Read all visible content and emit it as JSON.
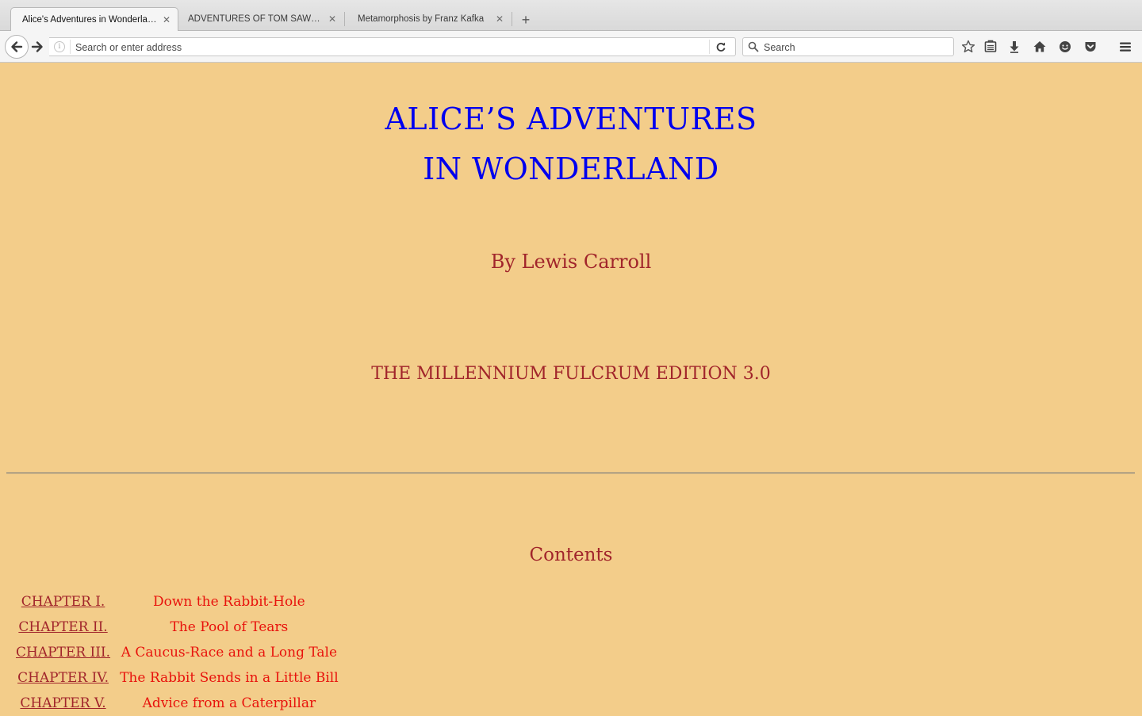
{
  "tabs": [
    {
      "label": "Alice's Adventures in Wonderla…",
      "active": true
    },
    {
      "label": "ADVENTURES OF TOM SAWYE…",
      "active": false
    },
    {
      "label": "Metamorphosis by Franz Kafka",
      "active": false
    }
  ],
  "tab_close_glyph": "✕",
  "new_tab_glyph": "+",
  "urlbar": {
    "placeholder": "Search or enter address",
    "value": ""
  },
  "searchbar": {
    "placeholder": "Search",
    "value": ""
  },
  "toolbar_icons": [
    "star-icon",
    "reading-list-icon",
    "download-icon",
    "home-icon",
    "hello-icon",
    "pocket-icon",
    "menu-icon"
  ],
  "page": {
    "title_line1": "ALICE’S ADVENTURES",
    "title_line2": "IN WONDERLAND",
    "author": "By Lewis Carroll",
    "edition": "THE MILLENNIUM FULCRUM EDITION 3.0",
    "contents_heading": "Contents",
    "toc": [
      {
        "chapter": "CHAPTER I.",
        "title": "Down the Rabbit-Hole"
      },
      {
        "chapter": "CHAPTER II.",
        "title": "The Pool of Tears"
      },
      {
        "chapter": "CHAPTER III.",
        "title": "A Caucus-Race and a Long Tale"
      },
      {
        "chapter": "CHAPTER IV.",
        "title": "The Rabbit Sends in a Little Bill"
      },
      {
        "chapter": "CHAPTER V.",
        "title": "Advice from a Caterpillar"
      }
    ]
  },
  "colors": {
    "page_background": "#f3cd8a",
    "title": "#0000ee",
    "author": "#a1252b",
    "chapter_title": "#e8120c"
  }
}
